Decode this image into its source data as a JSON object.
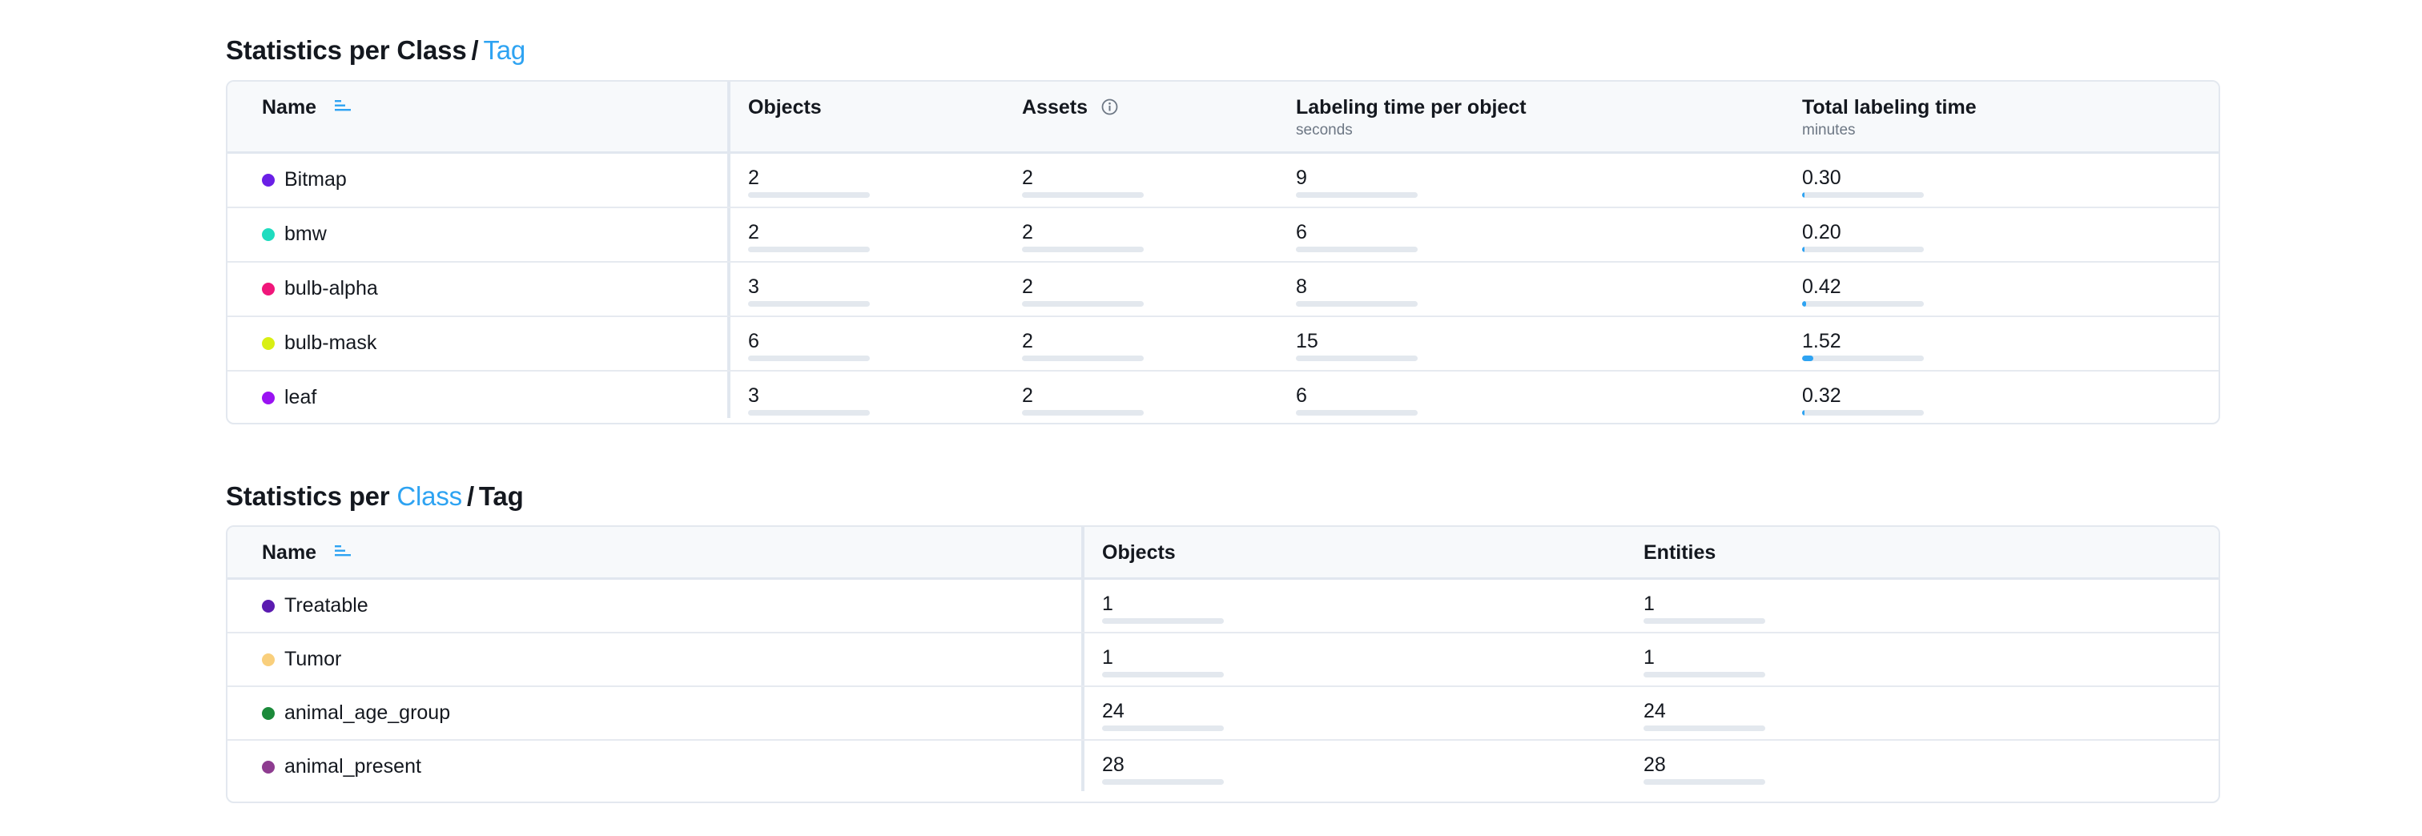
{
  "sections": [
    {
      "title_prefix": "Statistics per Class",
      "title_separator": "/",
      "title_suffix": "Tag",
      "columns": {
        "name": "Name",
        "objects": "Objects",
        "assets": "Assets",
        "time_per_object": "Labeling time per object",
        "time_per_object_unit": "seconds",
        "total_time": "Total labeling time",
        "total_time_unit": "minutes"
      },
      "rows": [
        {
          "name": "Bitmap",
          "color": "#6a1fe6",
          "objects": "2",
          "assets": "2",
          "time_per_object": "9",
          "total_time": "0.30",
          "total_time_fill": 0.02
        },
        {
          "name": "bmw",
          "color": "#1fdcbf",
          "objects": "2",
          "assets": "2",
          "time_per_object": "6",
          "total_time": "0.20",
          "total_time_fill": 0.015
        },
        {
          "name": "bulb-alpha",
          "color": "#f0167a",
          "objects": "3",
          "assets": "2",
          "time_per_object": "8",
          "total_time": "0.42",
          "total_time_fill": 0.03
        },
        {
          "name": "bulb-mask",
          "color": "#d9ef13",
          "objects": "6",
          "assets": "2",
          "time_per_object": "15",
          "total_time": "1.52",
          "total_time_fill": 0.09
        },
        {
          "name": "leaf",
          "color": "#9a12f2",
          "objects": "3",
          "assets": "2",
          "time_per_object": "6",
          "total_time": "0.32",
          "total_time_fill": 0.02
        }
      ]
    },
    {
      "title_prefix": "Statistics per",
      "title_link": "Class",
      "title_separator": "/",
      "title_suffix": "Tag",
      "columns": {
        "name": "Name",
        "objects": "Objects",
        "entities": "Entities"
      },
      "rows": [
        {
          "name": "Treatable",
          "color": "#5b1bb0",
          "objects": "1",
          "entities": "1"
        },
        {
          "name": "Tumor",
          "color": "#f9cf7c",
          "objects": "1",
          "entities": "1"
        },
        {
          "name": "animal_age_group",
          "color": "#1b8a3a",
          "objects": "24",
          "entities": "24"
        },
        {
          "name": "animal_present",
          "color": "#8e3c90",
          "objects": "28",
          "entities": "28"
        }
      ]
    }
  ],
  "colors": {
    "accent": "#2ea3f2",
    "bar_track": "#e3e8ee",
    "border": "#e3e8ef",
    "header_bg": "#f7f9fb"
  }
}
